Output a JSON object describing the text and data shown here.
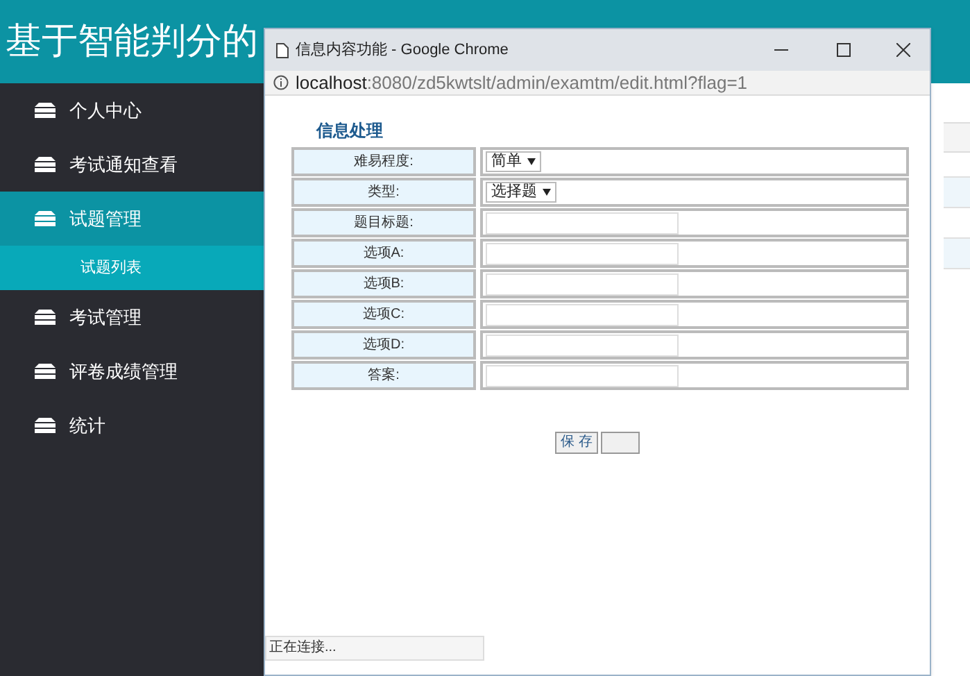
{
  "app_title": "基于智能判分的",
  "sidebar": {
    "items": [
      {
        "label": "个人中心",
        "selected": false
      },
      {
        "label": "考试通知查看",
        "selected": false
      },
      {
        "label": "试题管理",
        "selected": true,
        "children": [
          {
            "label": "试题列表"
          }
        ]
      },
      {
        "label": "考试管理",
        "selected": false
      },
      {
        "label": "评卷成绩管理",
        "selected": false
      },
      {
        "label": "统计",
        "selected": false
      }
    ]
  },
  "popup": {
    "title": "信息内容功能 - Google Chrome",
    "url_host": "localhost",
    "url_rest": ":8080/zd5kwtslt/admin/examtm/edit.html?flag=1",
    "heading": "信息处理",
    "fields": [
      {
        "label": "难易程度:",
        "kind": "select",
        "value": "简单"
      },
      {
        "label": "类型:",
        "kind": "select",
        "value": "选择题"
      },
      {
        "label": "题目标题:",
        "kind": "text"
      },
      {
        "label": "选项A:",
        "kind": "text"
      },
      {
        "label": "选项B:",
        "kind": "text"
      },
      {
        "label": "选项C:",
        "kind": "text"
      },
      {
        "label": "选项D:",
        "kind": "text"
      },
      {
        "label": "答案:",
        "kind": "text"
      }
    ],
    "buttons": [
      {
        "kind": "labeled",
        "label": "保 存"
      },
      {
        "kind": "blank"
      }
    ],
    "status": "正在连接..."
  }
}
